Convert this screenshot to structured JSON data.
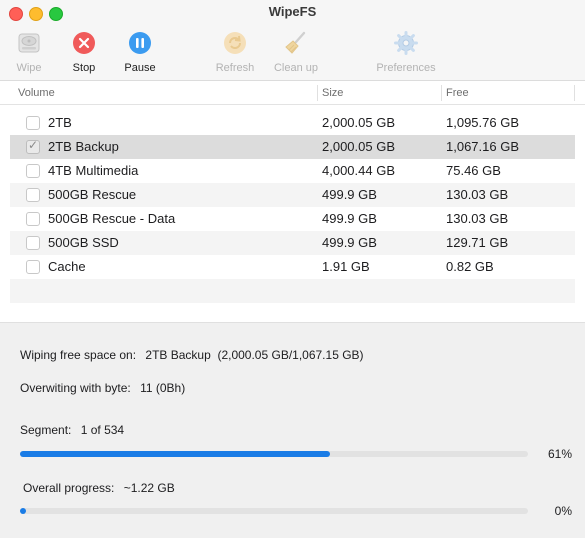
{
  "window": {
    "title": "WipeFS"
  },
  "toolbar": {
    "wipe": "Wipe",
    "stop": "Stop",
    "pause": "Pause",
    "refresh": "Refresh",
    "cleanup": "Clean up",
    "preferences": "Preferences"
  },
  "table": {
    "headers": {
      "volume": "Volume",
      "size": "Size",
      "free": "Free"
    },
    "rows": [
      {
        "volume": "2TB",
        "size": "2,000.05 GB",
        "free": "1,095.76 GB",
        "checked": false
      },
      {
        "volume": "2TB Backup",
        "size": "2,000.05 GB",
        "free": "1,067.16 GB",
        "checked": true
      },
      {
        "volume": "4TB Multimedia",
        "size": "4,000.44 GB",
        "free": "75.46 GB",
        "checked": false
      },
      {
        "volume": "500GB Rescue",
        "size": "499.9 GB",
        "free": "130.03 GB",
        "checked": false
      },
      {
        "volume": "500GB Rescue - Data",
        "size": "499.9 GB",
        "free": "130.03 GB",
        "checked": false
      },
      {
        "volume": "500GB SSD",
        "size": "499.9 GB",
        "free": "129.71 GB",
        "checked": false
      },
      {
        "volume": "Cache",
        "size": "1.91 GB",
        "free": "0.82 GB",
        "checked": false
      }
    ]
  },
  "status": {
    "wiping_label": "Wiping free space on:",
    "wiping_value": "2TB Backup  (2,000.05 GB/1,067.15 GB)",
    "overwriting_label": "Overwiting with byte:",
    "overwriting_value": "11 (0Bh)",
    "segment_label": "Segment:",
    "segment_value": "1 of 534",
    "segment_percent": "61%",
    "segment_progress": 0.61,
    "overall_label": "Overall progress:",
    "overall_value": "~1.22 GB",
    "overall_percent": "0%",
    "overall_progress": 0.01
  },
  "colors": {
    "accent": "#1a7ce6",
    "stop": "#f05a5a",
    "pause": "#3b9bf0"
  }
}
